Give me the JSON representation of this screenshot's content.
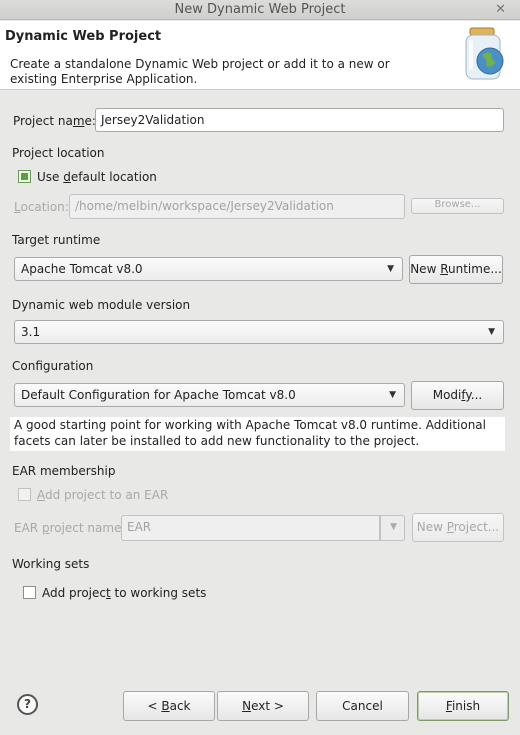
{
  "window": {
    "title": "New Dynamic Web Project"
  },
  "banner": {
    "title": "Dynamic Web Project",
    "description": "Create a standalone Dynamic Web project or add it to a new or existing Enterprise Application."
  },
  "project_name": {
    "pre": "Project na",
    "mn": "m",
    "post": "e:",
    "value": "Jersey2Validation"
  },
  "project_location": {
    "heading": "Project location",
    "use_default": {
      "pre": "Use ",
      "mn": "d",
      "post": "efault location",
      "checked": true
    },
    "location_label": {
      "mn": "L",
      "post": "ocation:"
    },
    "location_value": "/home/melbin/workspace/Jersey2Validation",
    "browse_label": "Browse..."
  },
  "target_runtime": {
    "heading": "Target runtime",
    "selected": "Apache Tomcat v8.0",
    "new_runtime": {
      "pre": "New ",
      "mn": "R",
      "post": "untime..."
    }
  },
  "module_version": {
    "heading": "Dynamic web module version",
    "selected": "3.1"
  },
  "configuration": {
    "heading": "Configuration",
    "selected": "Default Configuration for Apache Tomcat v8.0",
    "modify": {
      "pre": "Modi",
      "mn": "f",
      "post": "y..."
    },
    "info": "A good starting point for working with Apache Tomcat v8.0 runtime. Additional facets can later be installed to add new functionality to the project."
  },
  "ear": {
    "heading": "EAR membership",
    "add_to_ear": {
      "pre": "",
      "mn": "A",
      "post": "dd project to an EAR",
      "checked": false
    },
    "name_label": {
      "pre": "EAR ",
      "mn": "p",
      "post": "roject name:"
    },
    "name_value": "EAR",
    "new_project": {
      "pre": "New ",
      "mn": "P",
      "post": "roject..."
    }
  },
  "working_sets": {
    "heading": "Working sets",
    "add": {
      "pre": "Add projec",
      "mn": "t",
      "post": " to working sets",
      "checked": false
    }
  },
  "footer": {
    "help_glyph": "?",
    "back": {
      "pre": "< ",
      "mn": "B",
      "post": "ack"
    },
    "next": {
      "pre": "",
      "mn": "N",
      "post": "ext >"
    },
    "cancel": "Cancel",
    "finish": {
      "pre": "",
      "mn": "F",
      "post": "inish"
    }
  }
}
